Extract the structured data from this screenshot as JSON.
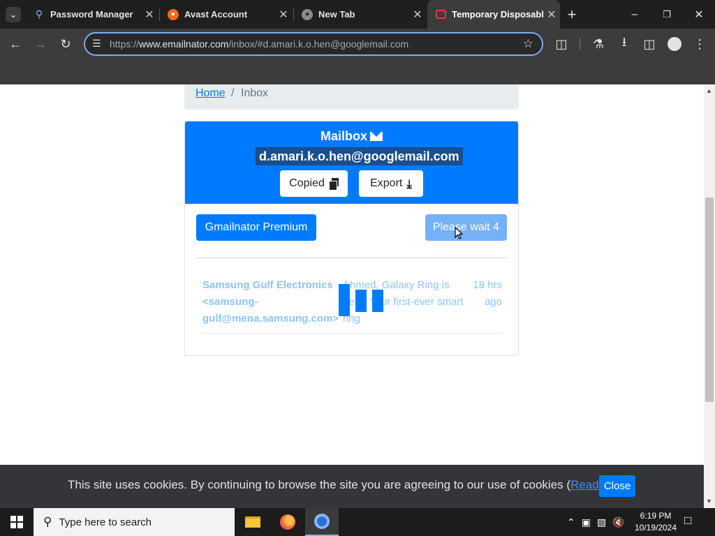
{
  "browser": {
    "tabs": [
      {
        "title": "Password Manager",
        "icon": "key-icon"
      },
      {
        "title": "Avast Account",
        "icon": "avast-icon"
      },
      {
        "title": "New Tab",
        "icon": "globe-icon"
      },
      {
        "title": "Temporary Disposable",
        "icon": "mail-icon"
      }
    ],
    "url_prefix": "https://",
    "url_domain": "www.emailnator.com",
    "url_path": "/inbox/#d.amari.k.o.hen@googlemail.com"
  },
  "breadcrumb": {
    "home": "Home",
    "separator": "/",
    "current": "Inbox"
  },
  "mailbox": {
    "title": "Mailbox",
    "email": "d.amari.k.o.hen@googlemail.com",
    "copied_label": "Copied",
    "export_label": "Export"
  },
  "actions": {
    "premium_label": "Gmailnator Premium",
    "wait_label": "Please wait 4"
  },
  "messages": [
    {
      "sender": "Samsung Gulf Electronics <samsung-gulf@mena.samsung.com>",
      "subject": "Ahmed, Galaxy Ring is here: Your first-ever smart ring",
      "time": "18 hrs ago"
    }
  ],
  "cookie": {
    "text": "This site uses cookies. By continuing to browse the site you are agreeing to our use of cookies (",
    "link": "Read more",
    "text_end": ")",
    "close_label": "Close"
  },
  "taskbar": {
    "search_placeholder": "Type here to search",
    "time": "6:19 PM",
    "date": "10/19/2024"
  },
  "colors": {
    "accent": "#007bff",
    "chrome_bg": "#3c3c3c",
    "tabstrip_bg": "#1f1f1f"
  }
}
